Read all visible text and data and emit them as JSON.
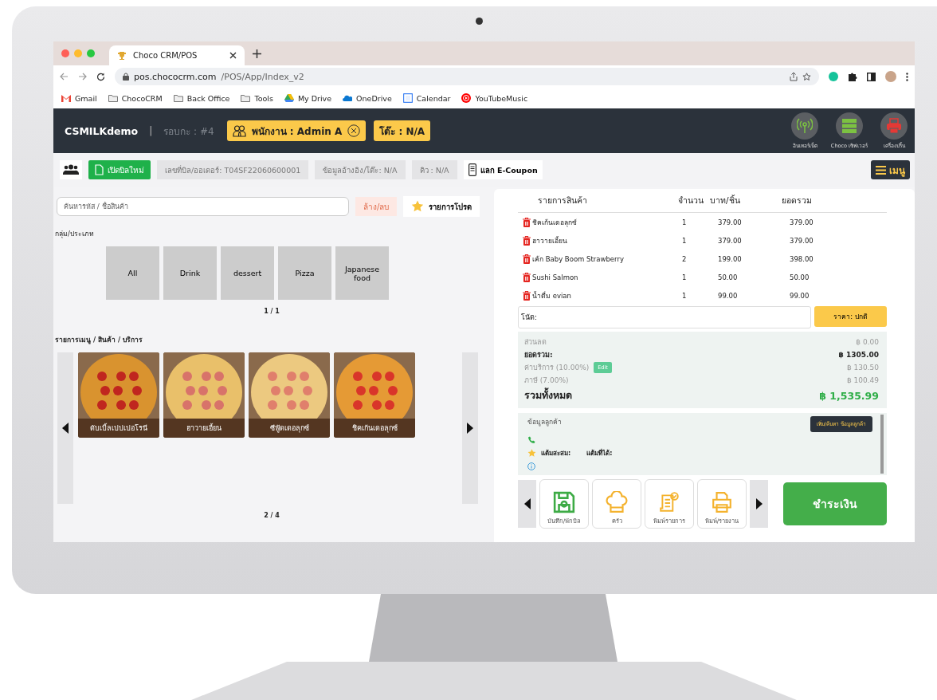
{
  "browser": {
    "tabs": [
      {
        "title": "Choco CRM/POS",
        "selected": true
      }
    ],
    "url": {
      "host": "pos.chococrm.com",
      "path": "/POS/App/Index_v2"
    },
    "bookmarks": [
      {
        "label": "Gmail",
        "kind": "gmail"
      },
      {
        "label": "ChocoCRM",
        "kind": "folder"
      },
      {
        "label": "Back Office",
        "kind": "folder"
      },
      {
        "label": "Tools",
        "kind": "folder"
      },
      {
        "label": "My Drive",
        "kind": "drive"
      },
      {
        "label": "OneDrive",
        "kind": "onedrive"
      },
      {
        "label": "Calendar",
        "kind": "calendar"
      },
      {
        "label": "YouTubeMusic",
        "kind": "youtube"
      }
    ]
  },
  "header": {
    "brand": "CSMILKdemo",
    "separator": "|",
    "shift": "รอบกะ : #4",
    "staff": "พนักงาน : Admin A",
    "table": "โต๊ะ : N/A",
    "statuses": [
      {
        "label": "อินเทอร์เน็ต",
        "kind": "internet",
        "color": "#7cc242"
      },
      {
        "label": "Choco เซิฟเวอร์",
        "kind": "server",
        "color": "#7cc242"
      },
      {
        "label": "เครื่องปริ้น",
        "kind": "printer",
        "color": "#e53935"
      }
    ]
  },
  "toolbar": {
    "new_bill": "เปิดบิลใหม่",
    "bill_number": "เลขที่บิล/ออเดอร์: T04SF22060600001",
    "reference": "ข้อมูลอ้างอิง/โต๊ะ: N/A",
    "queue": "คิว : N/A",
    "coupon": "แลก E-Coupon",
    "menu": "เมนู"
  },
  "catalog": {
    "search": {
      "placeholder": "ค้นหารหัส / ชื่อสินค้า"
    },
    "clear": "ล้าง/ลบ",
    "favorites": "รายการโปรด",
    "group_label": "กลุ่ม/ประเภท",
    "categories": [
      "All",
      "Drink",
      "dessert",
      "Pizza",
      "Japanese food"
    ],
    "category_page": "1 / 1",
    "menu_label": "รายการเมนู / สินค้า / บริการ",
    "products": [
      "ดับเบิ้ลเปปเปอโรนี",
      "ฮาวายเอี้ยน",
      "ซีฟู้ดเดอลุกซ์",
      "ชิคเก้นเดอลุกซ์"
    ],
    "product_page": "2 / 4"
  },
  "order": {
    "columns": [
      "รายการสินค้า",
      "จำนวน",
      "บาท/ชิ้น",
      "ยอดรวม"
    ],
    "rows": [
      {
        "name": "ชิคเก้นเดอลุกซ์",
        "qty": "1",
        "price": "379.00",
        "total": "379.00"
      },
      {
        "name": "ฮาวายเอี้ยน",
        "qty": "1",
        "price": "379.00",
        "total": "379.00"
      },
      {
        "name": "เค้ก Baby Boom Strawberry",
        "qty": "2",
        "price": "199.00",
        "total": "398.00"
      },
      {
        "name": "Sushi Salmon",
        "qty": "1",
        "price": "50.00",
        "total": "50.00"
      },
      {
        "name": "น้ำดื่ม evian",
        "qty": "1",
        "price": "99.00",
        "total": "99.00"
      }
    ],
    "note_label": "โน้ต:",
    "price_mode": "ราคา: ปกติ",
    "totals": [
      {
        "kind": "minor",
        "label": "ส่วนลด",
        "value": "฿ 0.00"
      },
      {
        "kind": "subtotal",
        "label": "ยอดรวม:",
        "value": "฿ 1305.00"
      },
      {
        "kind": "minor",
        "label": "ค่าบริการ (10.00%)",
        "edit": "Edit",
        "value": "฿ 130.50"
      },
      {
        "kind": "minor",
        "label": "ภาษี (7.00%)",
        "value": "฿ 100.49"
      },
      {
        "kind": "grand",
        "label": "รวมทั้งหมด",
        "value": "฿ 1,535.99"
      }
    ],
    "customer": {
      "title": "ข้อมูลลูกค้า",
      "find": "เพิ่ม/ค้นหา ข้อมูลลูกค้า",
      "points_label": "แต้มสะสม:",
      "earned_label": "แต้มที่ได้:"
    },
    "actions": [
      {
        "label": "บันทึก/พักบิล",
        "kind": "save"
      },
      {
        "label": "ครัว",
        "kind": "kitchen"
      },
      {
        "label": "พิมพ์รายการ",
        "kind": "print-list"
      },
      {
        "label": "พิมพ์/รายงาน",
        "kind": "print"
      }
    ],
    "pay": "ชำระเงิน"
  }
}
